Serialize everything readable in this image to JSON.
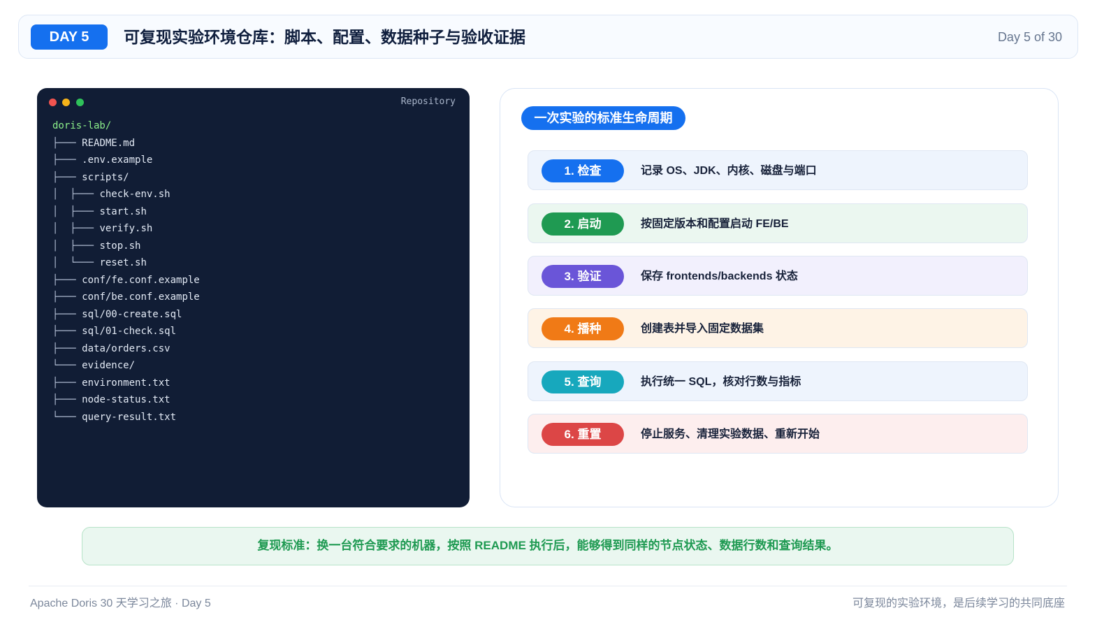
{
  "header": {
    "day_badge": "DAY 5",
    "title": "可复现实验环境仓库：脚本、配置、数据种子与验收证据",
    "counter": "Day 5 of 30"
  },
  "terminal": {
    "label": "Repository",
    "root": "doris-lab/",
    "lines": [
      {
        "prefix": "├─── ",
        "name": "README.md"
      },
      {
        "prefix": "├─── ",
        "name": ".env.example"
      },
      {
        "prefix": "├─── ",
        "name": "scripts/"
      },
      {
        "prefix": "│  ├─── ",
        "name": "check-env.sh"
      },
      {
        "prefix": "│  ├─── ",
        "name": "start.sh"
      },
      {
        "prefix": "│  ├─── ",
        "name": "verify.sh"
      },
      {
        "prefix": "│  ├─── ",
        "name": "stop.sh"
      },
      {
        "prefix": "│  └─── ",
        "name": "reset.sh"
      },
      {
        "prefix": "├─── ",
        "name": "conf/fe.conf.example"
      },
      {
        "prefix": "├─── ",
        "name": "conf/be.conf.example"
      },
      {
        "prefix": "├─── ",
        "name": "sql/00-create.sql"
      },
      {
        "prefix": "├─── ",
        "name": "sql/01-check.sql"
      },
      {
        "prefix": "├─── ",
        "name": "data/orders.csv"
      },
      {
        "prefix": "└─── ",
        "name": "evidence/"
      },
      {
        "prefix": "├─── ",
        "name": "environment.txt"
      },
      {
        "prefix": "├─── ",
        "name": "node-status.txt"
      },
      {
        "prefix": "└─── ",
        "name": "query-result.txt"
      }
    ]
  },
  "lifecycle": {
    "title": "一次实验的标准生命周期",
    "steps": [
      {
        "label": "1. 检查",
        "text": "记录 OS、JDK、内核、磁盘与端口",
        "color": "#1570ef",
        "bg": "#eef4fd"
      },
      {
        "label": "2. 启动",
        "text": "按固定版本和配置启动 FE/BE",
        "color": "#1f9a52",
        "bg": "#ebf7f0"
      },
      {
        "label": "3. 验证",
        "text": "保存 frontends/backends 状态",
        "color": "#6a55d8",
        "bg": "#f2f0fd"
      },
      {
        "label": "4. 播种",
        "text": "创建表并导入固定数据集",
        "color": "#f07a16",
        "bg": "#fef3e6"
      },
      {
        "label": "5. 查询",
        "text": "执行统一 SQL，核对行数与指标",
        "color": "#17a8bd",
        "bg": "#eef4fd"
      },
      {
        "label": "6. 重置",
        "text": "停止服务、清理实验数据、重新开始",
        "color": "#dc4646",
        "bg": "#fdeeee"
      }
    ]
  },
  "standard": "复现标准：换一台符合要求的机器，按照 README 执行后，能够得到同样的节点状态、数据行数和查询结果。",
  "footer": {
    "left": "Apache Doris 30 天学习之旅 · Day 5",
    "right": "可复现的实验环境，是后续学习的共同底座"
  }
}
